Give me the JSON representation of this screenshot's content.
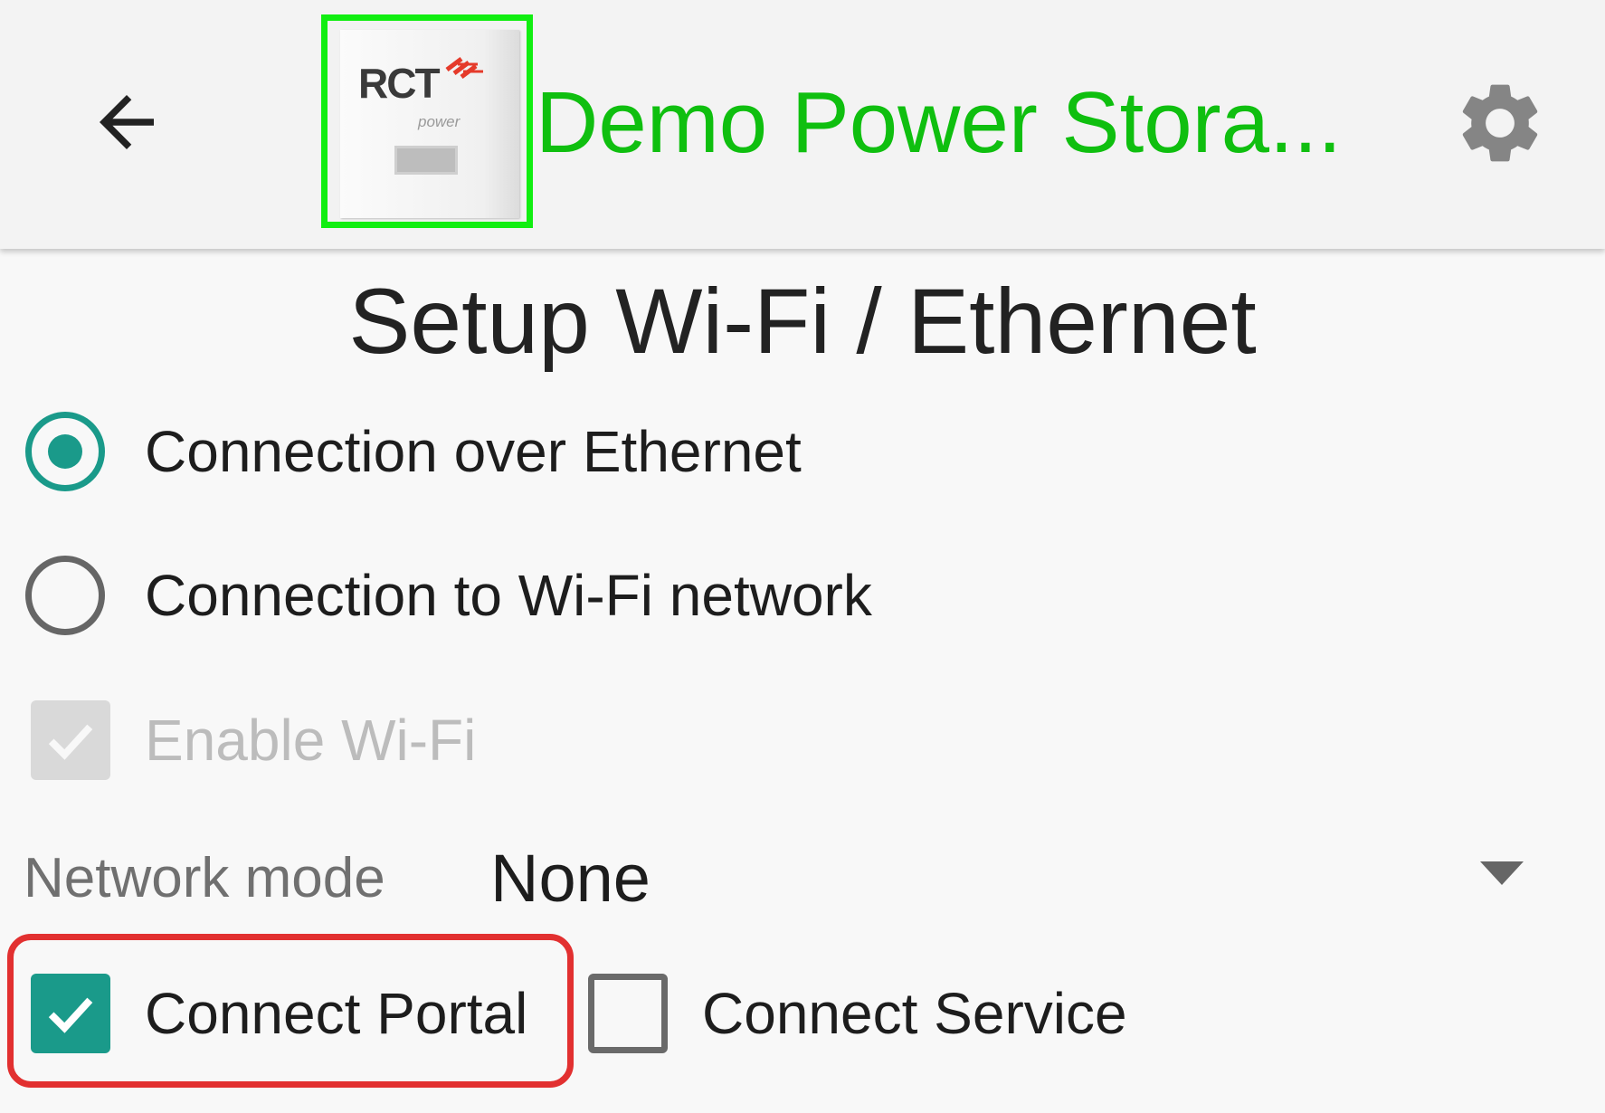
{
  "appbar": {
    "back_icon": "arrow-left-icon",
    "logo": {
      "brand": "RCT",
      "sub": "power"
    },
    "title": "Demo Power Stora...",
    "title_color": "#0fbf0f",
    "settings_icon": "gear-icon"
  },
  "page": {
    "title": "Setup Wi-Fi / Ethernet"
  },
  "connection_options": [
    {
      "label": "Connection over Ethernet",
      "selected": true
    },
    {
      "label": "Connection to Wi-Fi network",
      "selected": false
    }
  ],
  "wifi": {
    "label": "Enable Wi-Fi",
    "checked": true,
    "enabled": false
  },
  "network_mode": {
    "label": "Network mode",
    "value": "None"
  },
  "connect": {
    "portal_label": "Connect Portal",
    "portal_checked": true,
    "service_label": "Connect Service",
    "service_checked": false
  },
  "colors": {
    "accent": "#1a9a8a",
    "highlight_outline": "#e23030",
    "logo_outline": "#11ee11"
  }
}
